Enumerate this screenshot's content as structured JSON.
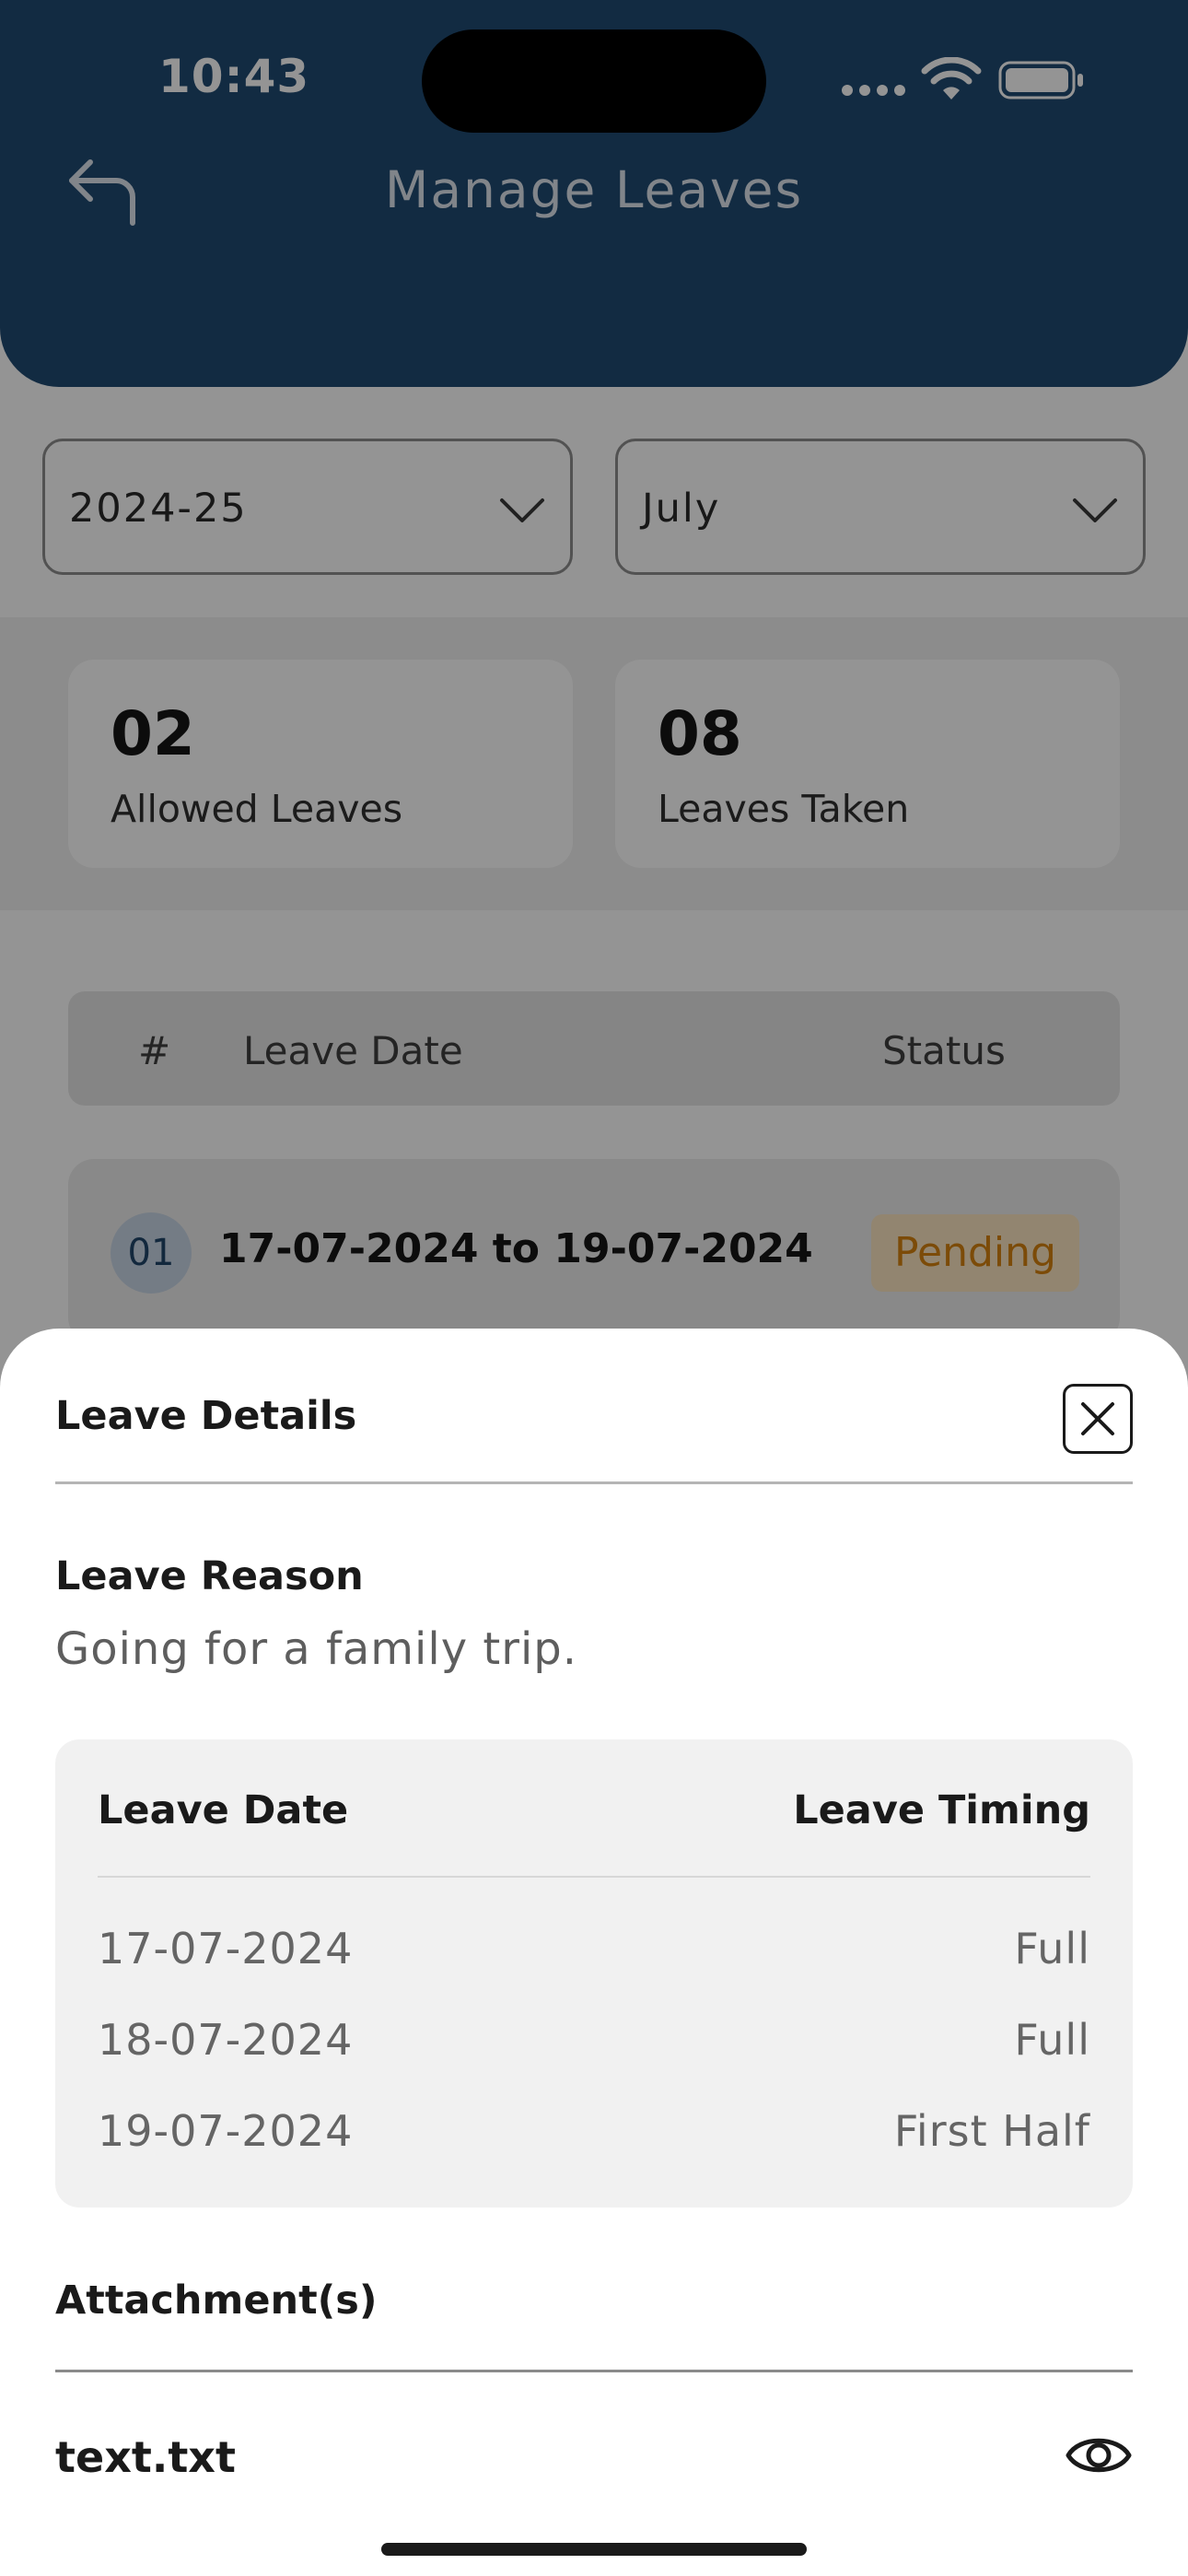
{
  "status_bar": {
    "time": "10:43"
  },
  "header": {
    "title": "Manage Leaves"
  },
  "filters": {
    "year": "2024-25",
    "month": "July"
  },
  "summary": {
    "allowed_value": "02",
    "allowed_label": "Allowed Leaves",
    "taken_value": "08",
    "taken_label": "Leaves Taken"
  },
  "leave_table": {
    "col_index": "#",
    "col_date": "Leave Date",
    "col_status": "Status",
    "rows": [
      {
        "index": "01",
        "date": "17-07-2024 to 19-07-2024",
        "status": "Pending"
      }
    ]
  },
  "sheet": {
    "title": "Leave Details",
    "reason_label": "Leave Reason",
    "reason_text": "Going for a family trip.",
    "dates_header_date": "Leave Date",
    "dates_header_timing": "Leave Timing",
    "dates": [
      {
        "date": "17-07-2024",
        "timing": "Full"
      },
      {
        "date": "18-07-2024",
        "timing": "Full"
      },
      {
        "date": "19-07-2024",
        "timing": "First Half"
      }
    ],
    "attachments_label": "Attachment(s)",
    "attachments": [
      {
        "name": "text.txt"
      }
    ]
  },
  "colors": {
    "header": "#1f4a72",
    "pending_text": "#d6820f",
    "pending_bg": "#fbe6c2",
    "index_badge": "#c9d6e6"
  },
  "icons": [
    "back-arrow-icon",
    "chevron-down-icon",
    "close-icon",
    "eye-icon",
    "wifi-icon",
    "battery-icon",
    "signal-icon"
  ]
}
